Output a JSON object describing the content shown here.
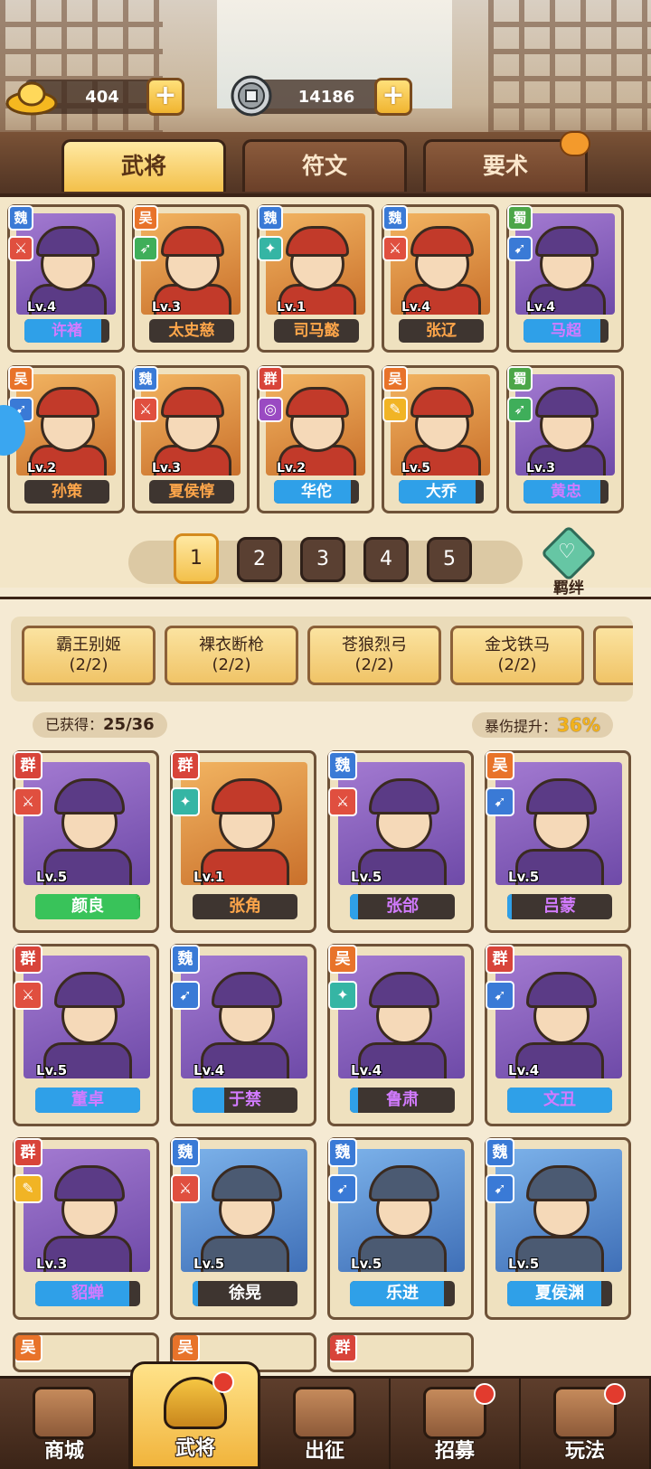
{
  "resources": {
    "gold": "404",
    "coins": "14186"
  },
  "tabs": [
    {
      "label": "武将",
      "active": true
    },
    {
      "label": "符文",
      "active": false
    },
    {
      "label": "要术",
      "active": false
    }
  ],
  "roster": [
    {
      "faction": "魏",
      "level": "Lv.4",
      "name": "许褚",
      "portrait": "purple",
      "weapon": "w-red",
      "fill": 0.9,
      "name_color": "purple-name"
    },
    {
      "faction": "吴",
      "level": "Lv.3",
      "name": "太史慈",
      "portrait": "orange",
      "weapon": "w-green",
      "fill": 0.0,
      "name_color": "orange-name"
    },
    {
      "faction": "魏",
      "level": "Lv.1",
      "name": "司马懿",
      "portrait": "orange",
      "weapon": "w-teal",
      "fill": 0.0,
      "name_color": "orange-name"
    },
    {
      "faction": "魏",
      "level": "Lv.4",
      "name": "张辽",
      "portrait": "orange",
      "weapon": "w-red",
      "fill": 0.0,
      "name_color": "orange-name"
    },
    {
      "faction": "蜀",
      "level": "Lv.4",
      "name": "马超",
      "portrait": "purple",
      "weapon": "w-blue",
      "fill": 0.9,
      "name_color": "purple-name"
    },
    {
      "faction": "吴",
      "level": "Lv.2",
      "name": "孙策",
      "portrait": "orange",
      "weapon": "w-blue",
      "fill": 0.0,
      "name_color": "orange-name"
    },
    {
      "faction": "魏",
      "level": "Lv.3",
      "name": "夏侯惇",
      "portrait": "orange",
      "weapon": "w-red",
      "fill": 0.0,
      "name_color": "orange-name"
    },
    {
      "faction": "群",
      "level": "Lv.2",
      "name": "华佗",
      "portrait": "orange",
      "weapon": "w-pv",
      "fill": 0.9,
      "name_color": "blue-name"
    },
    {
      "faction": "吴",
      "level": "Lv.5",
      "name": "大乔",
      "portrait": "orange",
      "weapon": "w-yel",
      "fill": 0.9,
      "name_color": "blue-name"
    },
    {
      "faction": "蜀",
      "level": "Lv.3",
      "name": "黄忠",
      "portrait": "purple",
      "weapon": "w-green",
      "fill": 0.9,
      "name_color": "purple-name"
    }
  ],
  "pages": [
    "1",
    "2",
    "3",
    "4",
    "5"
  ],
  "bond_label": "羁绊",
  "combos": [
    {
      "title": "霸王别姬",
      "progress": "(2/2)"
    },
    {
      "title": "裸衣断枪",
      "progress": "(2/2)"
    },
    {
      "title": "苍狼烈弓",
      "progress": "(2/2)"
    },
    {
      "title": "金戈铁马",
      "progress": "(2/2)"
    },
    {
      "title": "五",
      "progress": ""
    }
  ],
  "stats": {
    "obtained_label": "已获得：",
    "obtained_value": "25/36",
    "crit_label": "暴伤提升：",
    "crit_value": "36%"
  },
  "collection": [
    {
      "faction": "群",
      "level": "Lv.5",
      "name": "颜良",
      "portrait": "purple",
      "weapon": "w-red",
      "fill": 1.0,
      "bar": "green",
      "upgrade": true
    },
    {
      "faction": "群",
      "level": "Lv.1",
      "name": "张角",
      "portrait": "orange",
      "weapon": "w-teal",
      "fill": 0.0,
      "bar": "orange-name"
    },
    {
      "faction": "魏",
      "level": "Lv.5",
      "name": "张郃",
      "portrait": "purple",
      "weapon": "w-red",
      "fill": 0.08,
      "bar": "purple-name"
    },
    {
      "faction": "吴",
      "level": "Lv.5",
      "name": "吕蒙",
      "portrait": "purple",
      "weapon": "w-blue",
      "fill": 0.04,
      "bar": "purple-name"
    },
    {
      "faction": "群",
      "level": "Lv.5",
      "name": "董卓",
      "portrait": "purple",
      "weapon": "w-red",
      "fill": 1.0,
      "bar": "purple-name"
    },
    {
      "faction": "魏",
      "level": "Lv.4",
      "name": "于禁",
      "portrait": "purple",
      "weapon": "w-blue",
      "fill": 0.3,
      "bar": "purple-name"
    },
    {
      "faction": "吴",
      "level": "Lv.4",
      "name": "鲁肃",
      "portrait": "purple",
      "weapon": "w-teal",
      "fill": 0.08,
      "bar": "purple-name"
    },
    {
      "faction": "群",
      "level": "Lv.4",
      "name": "文丑",
      "portrait": "purple",
      "weapon": "w-blue",
      "fill": 1.0,
      "bar": "purple-name"
    },
    {
      "faction": "群",
      "level": "Lv.3",
      "name": "貂蝉",
      "portrait": "purple",
      "weapon": "w-yel",
      "fill": 0.9,
      "bar": "purple-name"
    },
    {
      "faction": "魏",
      "level": "Lv.5",
      "name": "徐晃",
      "portrait": "blue",
      "weapon": "w-red",
      "fill": 0.05,
      "bar": "blue-name"
    },
    {
      "faction": "魏",
      "level": "Lv.5",
      "name": "乐进",
      "portrait": "blue",
      "weapon": "w-blue",
      "fill": 0.9,
      "bar": "blue-name"
    },
    {
      "faction": "魏",
      "level": "Lv.5",
      "name": "夏侯渊",
      "portrait": "blue",
      "weapon": "w-blue",
      "fill": 0.9,
      "bar": "blue-name"
    }
  ],
  "collection_partial": [
    "吴",
    "吴",
    "群"
  ],
  "nav": [
    {
      "label": "商城",
      "active": false,
      "badge": false
    },
    {
      "label": "武将",
      "active": true,
      "badge": true
    },
    {
      "label": "出征",
      "active": false,
      "badge": false
    },
    {
      "label": "招募",
      "active": false,
      "badge": true
    },
    {
      "label": "玩法",
      "active": false,
      "badge": true
    }
  ]
}
